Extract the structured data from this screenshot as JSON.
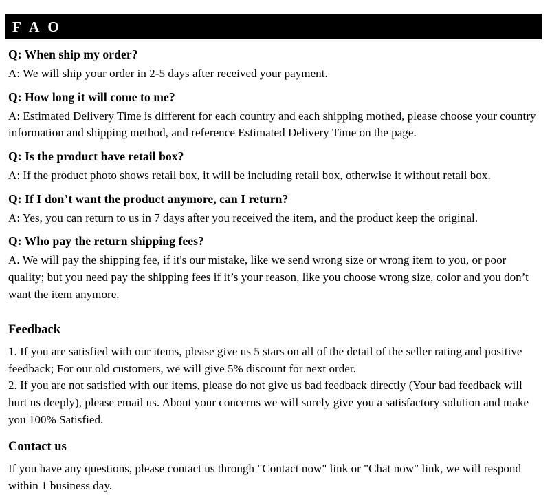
{
  "banner": {
    "title": "F A O",
    "background_color": "#000000",
    "text_color": "#ffffff"
  },
  "faq": {
    "items": [
      {
        "question": "Q: When ship my order?",
        "answer": "A: We will ship your order in 2-5 days after received your payment."
      },
      {
        "question": "Q: How long it will come to me?",
        "answer": "A: Estimated Delivery Time is different for each country and each shipping mothed, please choose your country information and shipping method, and reference Estimated Delivery Time on the page."
      },
      {
        "question": "Q: Is the product have retail box?",
        "answer": "A: If  the product photo shows retail box, it will be including retail box, otherwise it without retail box."
      },
      {
        "question": "Q: If I don’t want the product anymore, can I return?",
        "answer": "A: Yes, you can return to us in 7 days after you received the item, and the product keep the original."
      },
      {
        "question": "Q: Who pay the return shipping fees?",
        "answer": "A.  We will pay the shipping fee, if  it's our mistake, like we send wrong size or wrong item to you, or poor quality; but you need pay the shipping fees if  it’s your reason, like you choose wrong size, color and you don’t want the item anymore."
      }
    ]
  },
  "feedback": {
    "heading": "Feedback",
    "paragraphs": [
      "1.  If you are satisfied with our items, please give us 5 stars on all of the detail of the seller rating and positive feedback; For our old customers, we will give 5% discount for next order.",
      "2.  If you are not satisfied with our items, please do not give us bad feedback directly (Your bad feedback will hurt us deeply), please email us. About your concerns we will surely give you a satisfactory solution and make you 100% Satisfied."
    ]
  },
  "contact": {
    "heading": "Contact us",
    "paragraphs": [
      "If you have any questions, please contact us through \"Contact now\" link or \"Chat now\" link, we will respond within 1 business day."
    ]
  }
}
